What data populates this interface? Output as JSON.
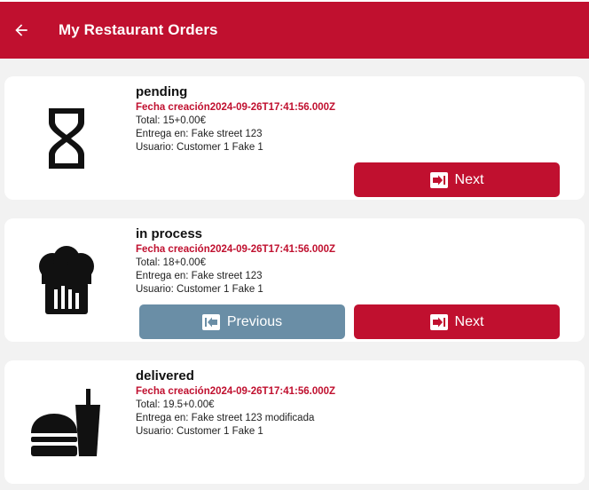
{
  "appbar": {
    "title": "My Restaurant Orders",
    "back_icon": "arrow-left-icon"
  },
  "colors": {
    "primary": "#c0102f",
    "secondary": "#6a8ea6",
    "background": "#f2f2f2",
    "card": "#ffffff"
  },
  "orders": [
    {
      "status": "pending",
      "icon": "hourglass-icon",
      "created": "Fecha creación2024-09-26T17:41:56.000Z",
      "total": "Total: 15+0.00€",
      "address": "Entrega en: Fake street 123",
      "user": "Usuario: Customer 1 Fake 1",
      "next_label": "Next"
    },
    {
      "status": "in process",
      "icon": "chef-hat-icon",
      "created": "Fecha creación2024-09-26T17:41:56.000Z",
      "total": "Total: 18+0.00€",
      "address": "Entrega en: Fake street 123",
      "user": "Usuario: Customer 1 Fake 1",
      "prev_label": "Previous",
      "next_label": "Next"
    },
    {
      "status": "delivered",
      "icon": "fastfood-icon",
      "created": "Fecha creación2024-09-26T17:41:56.000Z",
      "total": "Total: 19.5+0.00€",
      "address": "Entrega en: Fake street 123 modificada",
      "user": "Usuario: Customer 1 Fake 1"
    }
  ]
}
